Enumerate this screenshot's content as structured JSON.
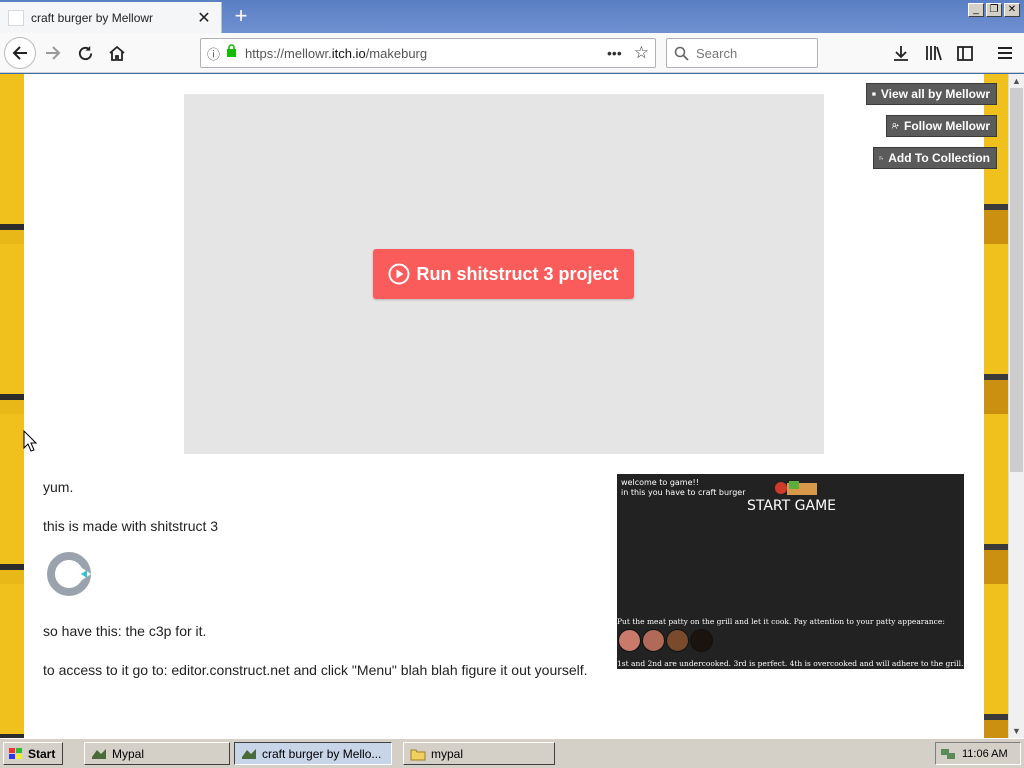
{
  "browser": {
    "tab_title": "craft burger by Mellowr",
    "url_prefix": "https://mellowr.",
    "url_host": "itch.io",
    "url_path": "/makeburg",
    "search_placeholder": "Search"
  },
  "page": {
    "run_button_label": "Run shitstruct 3 project",
    "user_buttons": {
      "view_all": "View all by Mellowr",
      "follow": "Follow Mellowr",
      "add_collection": "Add To Collection"
    },
    "description": {
      "p1": "yum.",
      "p2": "this is made with shitstruct 3",
      "p3": "so have this: the c3p for it.",
      "p4": "to access to it go to: editor.construct.net and click \"Menu\" blah blah figure it out yourself."
    },
    "screenshot": {
      "welcome_line1": "welcome to game!!",
      "welcome_line2": "in this you have to craft burger",
      "start_text": "START GAME",
      "instruction": "Put the meat patty on the grill and let it cook. Pay attention to your patty appearance:",
      "footer": "1st and 2nd are undercooked. 3rd is perfect. 4th is overcooked and will adhere to the grill.",
      "patty_colors": [
        "#c97a6a",
        "#b06a58",
        "#7a4a2c",
        "#1b130e"
      ]
    },
    "accent_color": "#fa5c5c"
  },
  "taskbar": {
    "start_label": "Start",
    "items": [
      {
        "label": "Mypal"
      },
      {
        "label": "craft burger by Mello..."
      },
      {
        "label": "mypal"
      }
    ],
    "clock": "11:06 AM"
  }
}
